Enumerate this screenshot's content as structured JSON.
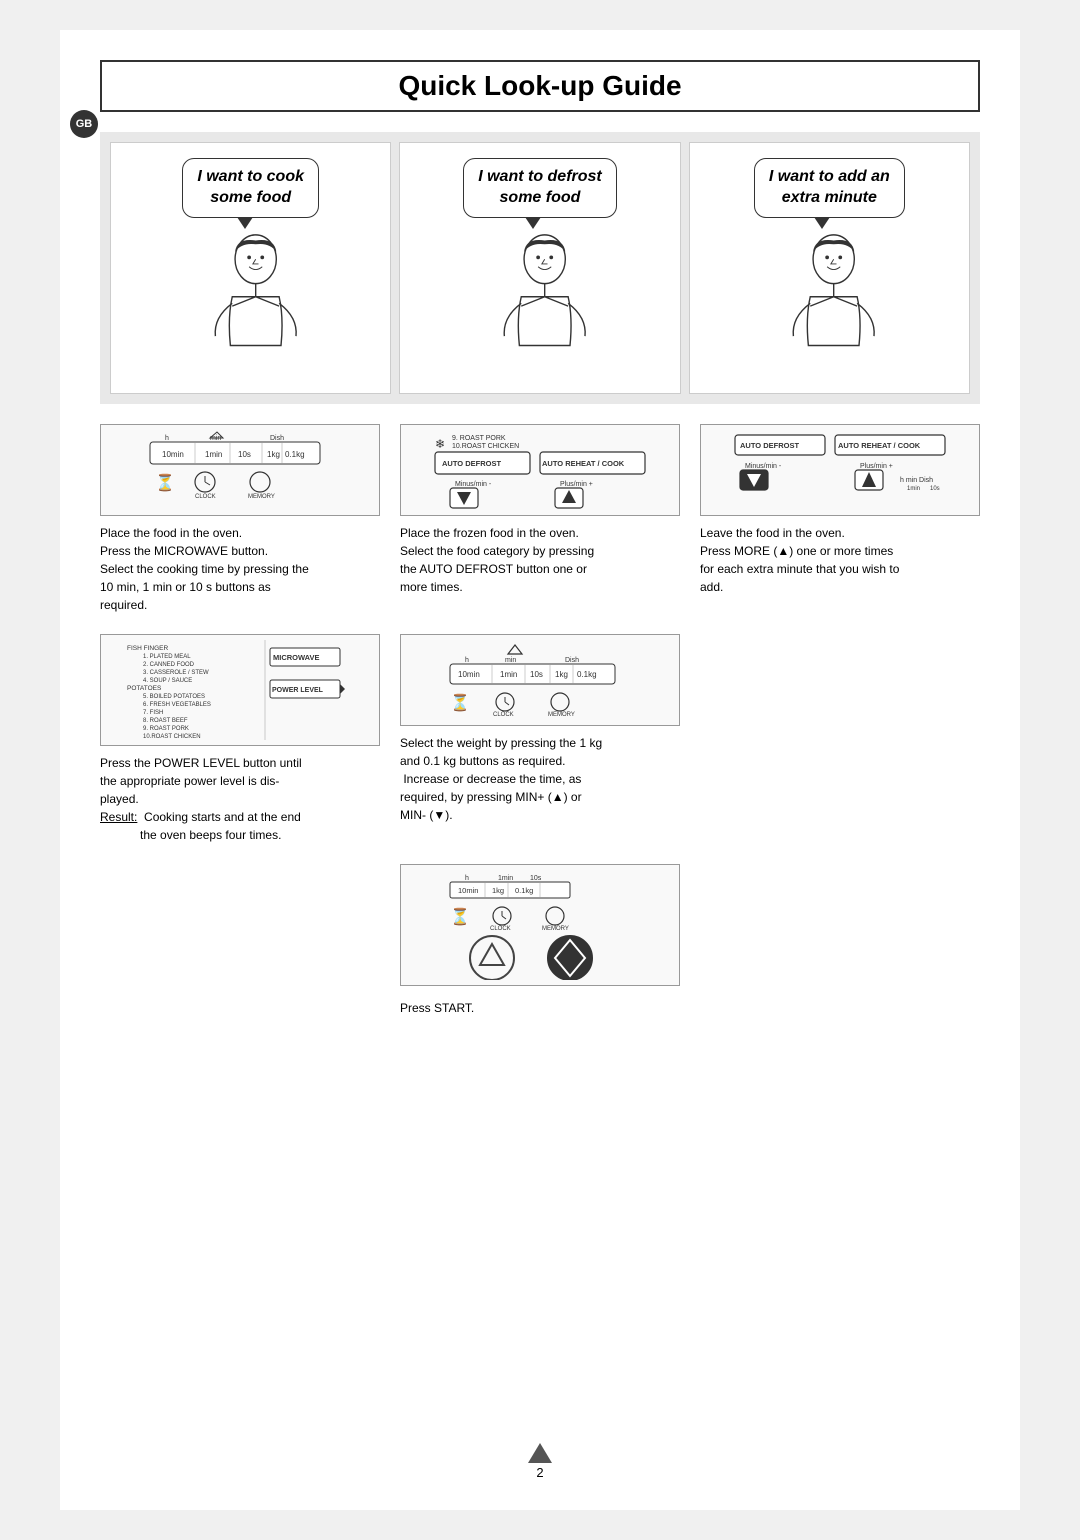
{
  "page": {
    "title": "Quick Look-up Guide",
    "gb_label": "GB",
    "page_number": "2"
  },
  "illustrations": [
    {
      "id": "cook",
      "bubble_line1": "I want to cook",
      "bubble_line2": "some food"
    },
    {
      "id": "defrost",
      "bubble_line1": "I want to defrost",
      "bubble_line2": "some food"
    },
    {
      "id": "extra",
      "bubble_line1": "I want to add an",
      "bubble_line2": "extra minute"
    }
  ],
  "steps": {
    "cook": {
      "panel1_desc": "Microwave control panel with time buttons",
      "text1": "Place the food in the oven.\nPress the MICROWAVE button.\nSelect the cooking time by pressing the\n10 min, 1 min or 10 s buttons as\nrequired.",
      "panel2_desc": "Microwave control panel with power level",
      "text2": "Press the POWER LEVEL button until\nthe appropriate power level is dis-\nplayed.\nResult: Cooking starts and at the end\nthe oven beeps four times."
    },
    "defrost": {
      "panel1_desc": "Auto defrost / Auto reheat panel with arrows",
      "text1": "Place the frozen food in the oven.\nSelect the food category by pressing\nthe AUTO DEFROST button one or\nmore times.",
      "panel2_desc": "Time panel with weight buttons",
      "text2": "Select the weight by pressing the 1 kg\nand 0.1 kg buttons as required.\nIncrease or decrease the time, as\nrequired, by pressing MIN+ (▲) or\nMIN- (▼).",
      "panel3_desc": "Start panel",
      "press_start": "Press START."
    },
    "extra": {
      "panel1_desc": "Auto defrost / Auto reheat panel",
      "text1": "Leave the food in the oven.\nPress MORE (▲) one or more times\nfor each extra minute that you wish to\nadd."
    }
  },
  "panel_labels": {
    "h": "h",
    "min": "min",
    "dish": "Dish",
    "10min": "10min",
    "1min": "1min",
    "10s": "10s",
    "1kg": "1kg",
    "01kg": "0.1kg",
    "memory": "MEMORY",
    "clock": "CLOCK",
    "auto_defrost": "AUTO DEFROST",
    "auto_reheat": "AUTO REHEAT / COOK",
    "minus_min": "Minus/min -",
    "plus_min": "Plus/min +",
    "microwave": "MICROWAVE",
    "power_level": "POWER LEVEL",
    "roast_pork": "9. ROAST PORK",
    "roast_chicken": "10.ROAST CHICKEN",
    "fish_finger": "FISH FINGER",
    "plated_meal": "1. PLATED MEAL",
    "canned_food": "2. CANNED FOOD",
    "casserole": "3. CASSEROLE / STEW",
    "soup": "4. SOUP / SAUCE",
    "boiled_potatoes": "5. BOILED POTATOES",
    "fresh_veg": "6. FRESH VEGETABLES",
    "fish": "7. FISH",
    "roast_beef": "8. ROAST BEEF",
    "potatoes": "POTATOES"
  }
}
